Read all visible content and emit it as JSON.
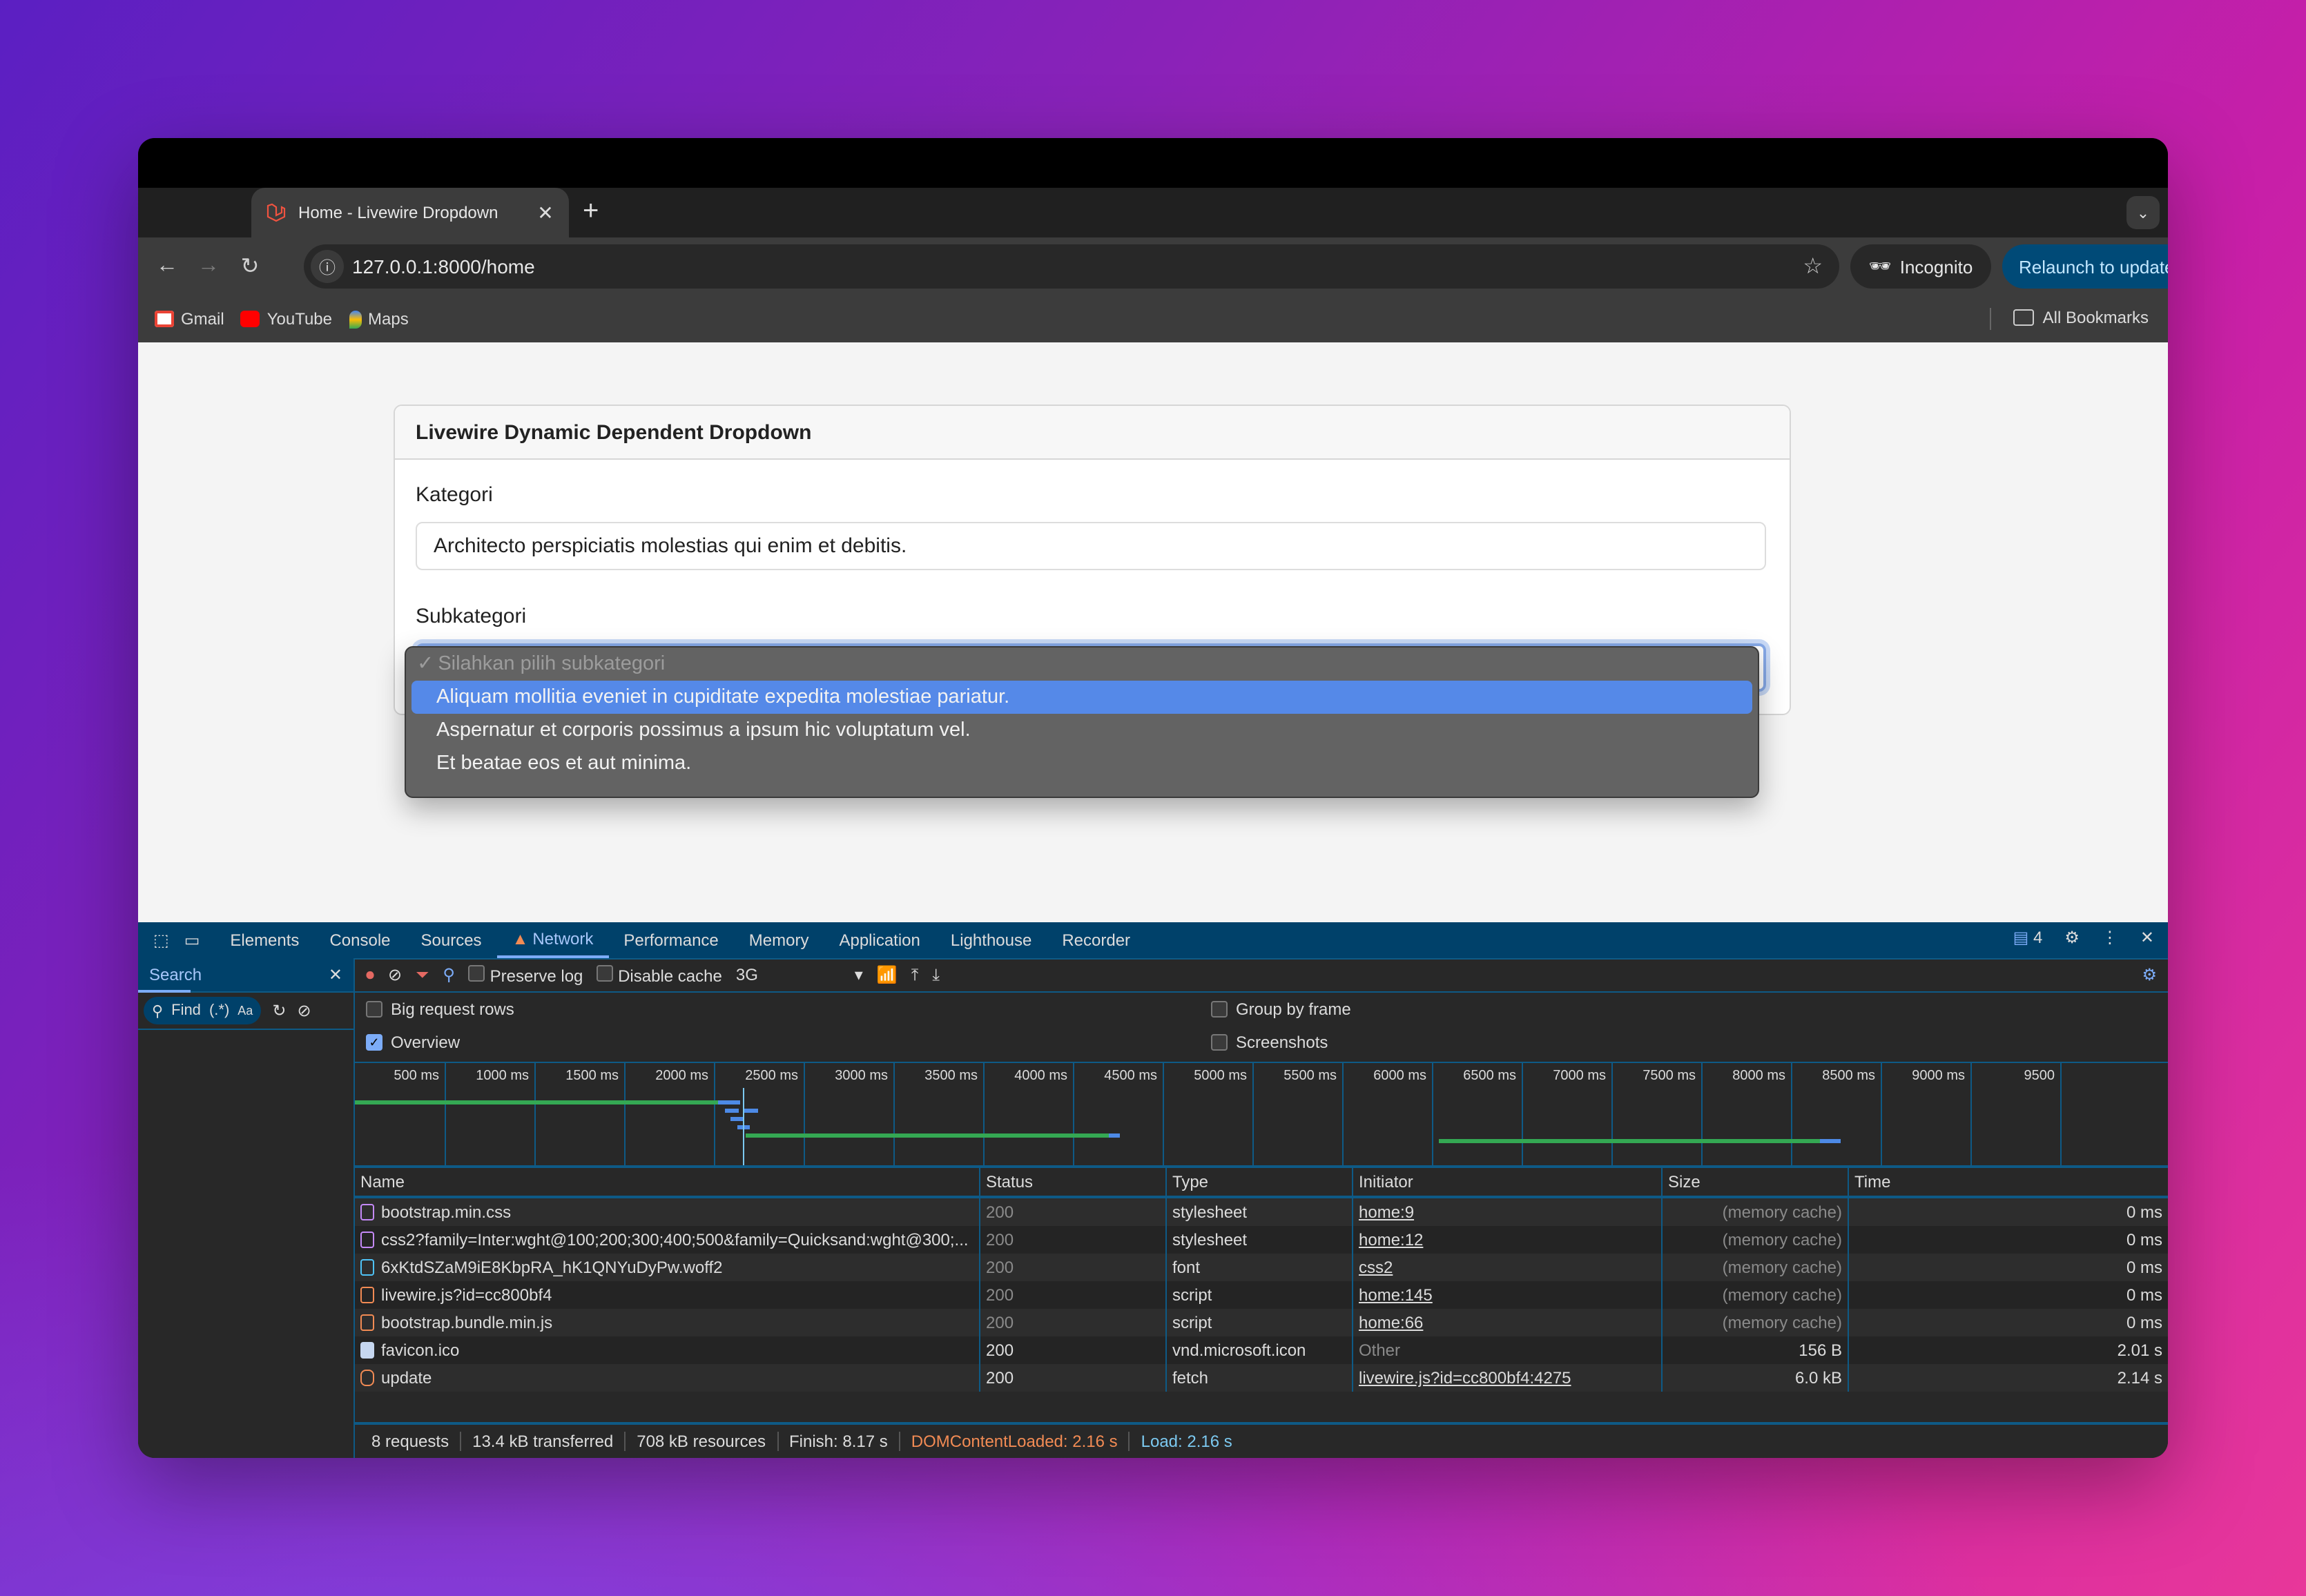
{
  "browser": {
    "tab_title": "Home - Livewire Dropdown",
    "url": "127.0.0.1:8000/home",
    "incognito_label": "Incognito",
    "relaunch_label": "Relaunch to update",
    "bookmarks": [
      {
        "label": "Gmail",
        "color": "#ea4335"
      },
      {
        "label": "YouTube",
        "color": "#ff0000"
      },
      {
        "label": "Maps",
        "color": "#34a853"
      }
    ],
    "all_bookmarks_label": "All Bookmarks"
  },
  "page": {
    "card_title": "Livewire Dynamic Dependent Dropdown",
    "kategori_label": "Kategori",
    "kategori_value": "Architecto perspiciatis molestias qui enim et debitis.",
    "subkategori_label": "Subkategori",
    "subkategori_placeholder": "Silahkan pilih subkategori",
    "subkategori_options": [
      "Aliquam mollitia eveniet in cupiditate expedita molestiae pariatur.",
      "Aspernatur et corporis possimus a ipsum hic voluptatum vel.",
      "Et beatae eos et aut minima."
    ],
    "highlighted_option_index": 0
  },
  "devtools": {
    "tabs": [
      "Elements",
      "Console",
      "Sources",
      "Network",
      "Performance",
      "Memory",
      "Application",
      "Lighthouse",
      "Recorder"
    ],
    "active_tab": "Network",
    "issues_count": "4",
    "drawer": {
      "title": "Search",
      "find_label": "Find",
      "regex_label": "(.*)",
      "case_label": "Aa"
    },
    "toolbar": {
      "preserve_log": "Preserve log",
      "disable_cache": "Disable cache",
      "throttling": "3G"
    },
    "options": {
      "big_request_rows": {
        "label": "Big request rows",
        "checked": false
      },
      "overview": {
        "label": "Overview",
        "checked": true
      },
      "group_by_frame": {
        "label": "Group by frame",
        "checked": false
      },
      "screenshots": {
        "label": "Screenshots",
        "checked": false
      }
    },
    "timeline_ticks": [
      "500 ms",
      "1000 ms",
      "1500 ms",
      "2000 ms",
      "2500 ms",
      "3000 ms",
      "3500 ms",
      "4000 ms",
      "4500 ms",
      "5000 ms",
      "5500 ms",
      "6000 ms",
      "6500 ms",
      "7000 ms",
      "7500 ms",
      "8000 ms",
      "8500 ms",
      "9000 ms",
      "9500"
    ],
    "columns": [
      "Name",
      "Status",
      "Type",
      "Initiator",
      "Size",
      "Time"
    ],
    "requests": [
      {
        "name": "bootstrap.min.css",
        "icon": "stylesheet",
        "status": "200",
        "type": "stylesheet",
        "initiator": "home:9",
        "initiator_link": true,
        "size": "(memory cache)",
        "time": "0 ms",
        "cached": true
      },
      {
        "name": "css2?family=Inter:wght@100;200;300;400;500&family=Quicksand:wght@300;...",
        "icon": "stylesheet",
        "status": "200",
        "type": "stylesheet",
        "initiator": "home:12",
        "initiator_link": true,
        "size": "(memory cache)",
        "time": "0 ms",
        "cached": true
      },
      {
        "name": "6xKtdSZaM9iE8KbpRA_hK1QNYuDyPw.woff2",
        "icon": "font",
        "status": "200",
        "type": "font",
        "initiator": "css2",
        "initiator_link": true,
        "size": "(memory cache)",
        "time": "0 ms",
        "cached": true
      },
      {
        "name": "livewire.js?id=cc800bf4",
        "icon": "script",
        "status": "200",
        "type": "script",
        "initiator": "home:145",
        "initiator_link": true,
        "size": "(memory cache)",
        "time": "0 ms",
        "cached": true
      },
      {
        "name": "bootstrap.bundle.min.js",
        "icon": "script",
        "status": "200",
        "type": "script",
        "initiator": "home:66",
        "initiator_link": true,
        "size": "(memory cache)",
        "time": "0 ms",
        "cached": true
      },
      {
        "name": "favicon.ico",
        "icon": "image",
        "status": "200",
        "type": "vnd.microsoft.icon",
        "initiator": "Other",
        "initiator_link": false,
        "size": "156 B",
        "time": "2.01 s",
        "cached": false
      },
      {
        "name": "update",
        "icon": "fetch",
        "status": "200",
        "type": "fetch",
        "initiator": "livewire.js?id=cc800bf4:4275",
        "initiator_link": true,
        "size": "6.0 kB",
        "time": "2.14 s",
        "cached": false
      }
    ],
    "summary": {
      "requests": "8 requests",
      "transferred": "13.4 kB transferred",
      "resources": "708 kB resources",
      "finish": "Finish: 8.17 s",
      "dom_content_loaded": "DOMContentLoaded: 2.16 s",
      "load": "Load: 2.16 s"
    },
    "colors": {
      "dcl": "#f28b54",
      "load": "#7cc9f0",
      "accent": "#7cacf8",
      "waiting": "#34a853",
      "download": "#4d8ae6"
    }
  }
}
